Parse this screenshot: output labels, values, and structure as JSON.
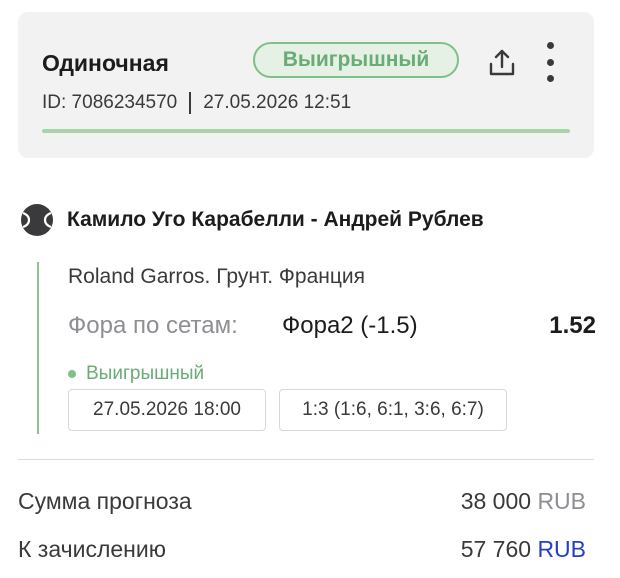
{
  "header": {
    "bet_type": "Одиночная",
    "status": "Выигрышный",
    "id_label": "ID: 7086234570",
    "datetime": "27.05.2026 12:51"
  },
  "icons": {
    "share": "share-icon",
    "more": "more-vertical-icon",
    "sport": "tennis-ball-icon"
  },
  "event": {
    "title": "Камило Уго Карабелли - Андрей Рублев",
    "tournament": "Roland Garros. Грунт. Франция",
    "market": "Фора по сетам:",
    "selection": "Фора2 (-1.5)",
    "odds": "1.52",
    "status": "Выигрышный",
    "start_time": "27.05.2026 18:00",
    "score": "1:3 (1:6, 6:1, 3:6, 6:7)"
  },
  "summary": {
    "stake_label": "Сумма прогноза",
    "stake_amount": "38 000",
    "stake_currency": "RUB",
    "payout_label": "К зачислению",
    "payout_amount": "57 760",
    "payout_currency": "RUB"
  },
  "colors": {
    "win_green": "#6bab77",
    "accent_blue": "#2440c0",
    "card_bg": "#f2f2f2"
  }
}
